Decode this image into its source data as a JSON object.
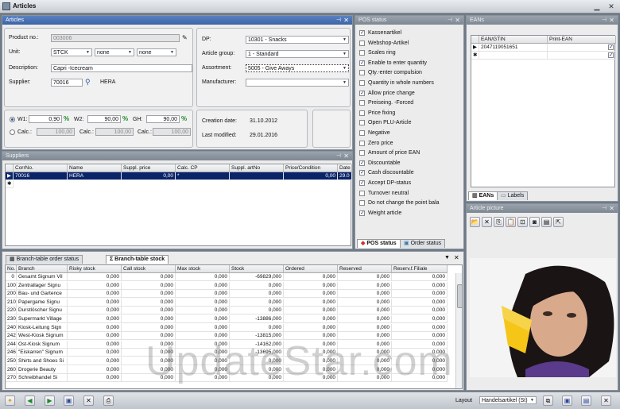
{
  "window": {
    "title": "Articles"
  },
  "articles_panel": {
    "title": "Articles"
  },
  "form": {
    "product_no_label": "Product no.:",
    "product_no": "003006",
    "unit_label": "Unit:",
    "unit": "STCK",
    "unit2": "none",
    "unit3": "none",
    "description_label": "Description:",
    "description": "Capri -Icecream",
    "supplier_label": "Supplier:",
    "supplier_no": "70016",
    "supplier_name": "HERA",
    "dp_label": "DP:",
    "dp": "10301 - Snacks",
    "article_group_label": "Article group:",
    "article_group": "1 - Standard",
    "assortment_label": "Assortment:",
    "assortment": "5005 - Give Aways",
    "manufacturer_label": "Manufacturer:",
    "manufacturer": "",
    "w1_label": "W1:",
    "w1": "0,90",
    "w2_label": "W2:",
    "w2": "90,00",
    "gh_label": "GH:",
    "gh": "90,00",
    "calc_label": "Calc.:",
    "calc1": "100,00",
    "calc2": "100,00",
    "calc3": "100,00",
    "creation_label": "Creation date:",
    "creation": "31.10.2012",
    "modified_label": "Last modified:",
    "modified": "29.01.2016"
  },
  "suppliers": {
    "title": "Suppliers",
    "columns": [
      "CorrNo.",
      "Name",
      "Suppl. price",
      "Calc. CP",
      "Suppl. artNo",
      "Price/Condition",
      "Date"
    ],
    "row": [
      "70016",
      "HERA",
      "0,00",
      "*",
      "",
      "0,00",
      "29.0"
    ]
  },
  "pos_status": {
    "title": "POS status",
    "items": [
      {
        "label": "Kassenartikel",
        "checked": true
      },
      {
        "label": "Webshop-Artikel",
        "checked": false
      },
      {
        "label": "Scales ring",
        "checked": false
      },
      {
        "label": "Enable to enter quantity",
        "checked": true
      },
      {
        "label": "Qty.-enter compulsion",
        "checked": false
      },
      {
        "label": "Quantity in whole numbers",
        "checked": false
      },
      {
        "label": "Allow price change",
        "checked": true
      },
      {
        "label": "Preiseing. -Forced",
        "checked": false
      },
      {
        "label": "Price fixing",
        "checked": false
      },
      {
        "label": "Open PLU-Article",
        "checked": false
      },
      {
        "label": "Negative",
        "checked": false
      },
      {
        "label": "Zero price",
        "checked": false
      },
      {
        "label": "Amount of price EAN",
        "checked": false
      },
      {
        "label": "Discountable",
        "checked": true
      },
      {
        "label": "Cash discountable",
        "checked": true
      },
      {
        "label": "Accept DP-status",
        "checked": true
      },
      {
        "label": "Turnover neutral",
        "checked": false
      },
      {
        "label": "Do not change the point bala",
        "checked": false
      },
      {
        "label": "Weight article",
        "checked": true
      }
    ],
    "tab_pos": "POS status",
    "tab_order": "Order status"
  },
  "eans": {
    "title": "EANs",
    "col1": "EAN/GTIN",
    "col2": "Print-EAN",
    "value": "2047119051651",
    "tab_eans": "EANs",
    "tab_labels": "Labels"
  },
  "article_picture": {
    "title": "Article picture"
  },
  "branch": {
    "tab1": "Branch-table order status",
    "tab2": "Branch-table stock",
    "columns": [
      "No.",
      "Branch",
      "Risky stock",
      "Call stock",
      "Max stock",
      "Stock",
      "Ordered",
      "Reserved",
      "Reserv.f.Filiale"
    ],
    "rows": [
      [
        "0",
        "Gesamt Signum Vil",
        "0,000",
        "0,000",
        "0,000",
        "-69829,000",
        "0,000",
        "0,000",
        "0,000"
      ],
      [
        "100",
        "Zentrallager Signu",
        "0,000",
        "0,000",
        "0,000",
        "0,000",
        "0,000",
        "0,000",
        "0,000"
      ],
      [
        "200",
        "Bau- und Gartence",
        "0,000",
        "0,000",
        "0,000",
        "0,000",
        "0,000",
        "0,000",
        "0,000"
      ],
      [
        "210",
        "Papergame Signu",
        "0,000",
        "0,000",
        "0,000",
        "0,000",
        "0,000",
        "0,000",
        "0,000"
      ],
      [
        "220",
        "Durstlöscher Signu",
        "0,000",
        "0,000",
        "0,000",
        "0,000",
        "0,000",
        "0,000",
        "0,000"
      ],
      [
        "230",
        "Supermarkt Village",
        "0,000",
        "0,000",
        "0,000",
        "-13886,000",
        "0,000",
        "0,000",
        "0,000"
      ],
      [
        "240",
        "Kiosk-Leitung Sign",
        "0,000",
        "0,000",
        "0,000",
        "0,000",
        "0,000",
        "0,000",
        "0,000"
      ],
      [
        "242",
        "West-Kiosk Signum",
        "0,000",
        "0,000",
        "0,000",
        "-13815,000",
        "0,000",
        "0,000",
        "0,000"
      ],
      [
        "244",
        "Ost-Kiosk Signum",
        "0,000",
        "0,000",
        "0,000",
        "-14162,000",
        "0,000",
        "0,000",
        "0,000"
      ],
      [
        "246",
        "\"Eiskarren\" Signum",
        "0,000",
        "0,000",
        "0,000",
        "-13695,000",
        "0,000",
        "0,000",
        "0,000"
      ],
      [
        "250",
        "Shirts and Shoes Si",
        "0,000",
        "0,000",
        "0,000",
        "0,000",
        "0,000",
        "0,000",
        "0,000"
      ],
      [
        "260",
        "Drogerie Beauty",
        "0,000",
        "0,000",
        "0,000",
        "0,000",
        "0,000",
        "0,000",
        "0,000"
      ],
      [
        "270",
        "Schreibhandel Si",
        "0,000",
        "0,000",
        "0,000",
        "0,000",
        "0,000",
        "0,000",
        "0,000"
      ]
    ]
  },
  "footer": {
    "layout_label": "Layout",
    "layout_value": "Handelsartikel (St)"
  },
  "watermark": "UpdateStar.com"
}
